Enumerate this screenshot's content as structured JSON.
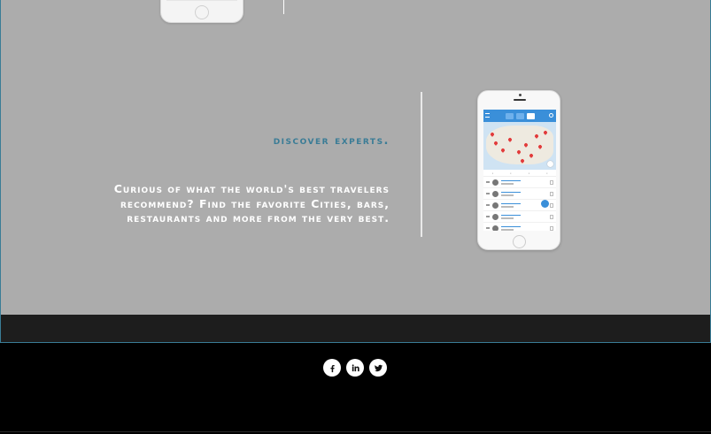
{
  "feature": {
    "headline": "discover experts.",
    "description": "Curious of what the world's best travelers recommend? Find the favorite Cities, bars, restaurants and more from the very best."
  },
  "phone_mockup": {
    "top_tabs": [
      "list-icon",
      "map-icon",
      "profile-icon"
    ],
    "list_rows": 5
  },
  "footer": {
    "social_links": [
      {
        "name": "facebook",
        "icon": "facebook-icon"
      },
      {
        "name": "linkedin",
        "icon": "linkedin-icon"
      },
      {
        "name": "twitter",
        "icon": "twitter-icon"
      }
    ]
  },
  "colors": {
    "accent": "#3a7c96",
    "section_bg": "#acacac",
    "footer_bg": "#000000",
    "band_bg": "#1d1d1d"
  }
}
